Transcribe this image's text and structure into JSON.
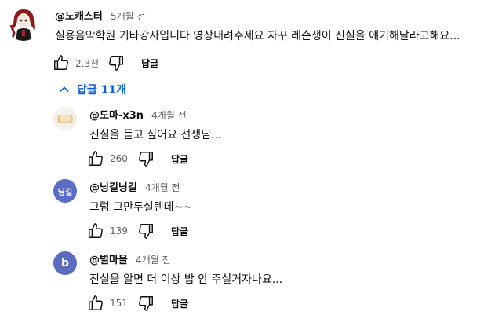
{
  "top_comment": {
    "author": "@노캐스터",
    "time": "5개월 전",
    "text": "실용음악학원 기타강사입니다 영상내려주세요 자꾸 레슨생이 진실을 얘기해달라고해요...",
    "likes": "2.3천",
    "reply_label": "답글"
  },
  "replies_toggle": {
    "label": "답글 11개",
    "icon": "chevron-up-icon"
  },
  "replies": [
    {
      "author": "@도마-x3n",
      "time": "4개월 전",
      "text": "진실을 듣고 싶어요 선생님...",
      "likes": "260",
      "reply_label": "답글",
      "avatar_color": "#f0ece4"
    },
    {
      "author": "@닝길닝길",
      "time": "4개월 전",
      "text": "그럼 그만두실텐데~~",
      "likes": "139",
      "reply_label": "답글",
      "avatar_text": "닝길",
      "avatar_color": "#5a6cc4"
    },
    {
      "author": "@별마을",
      "time": "4개월 전",
      "text": "진실을 알면 더 이상 밥 안 주실거자나요...",
      "likes": "151",
      "reply_label": "답글",
      "avatar_text": "b",
      "avatar_color": "#5c6bc0"
    }
  ]
}
